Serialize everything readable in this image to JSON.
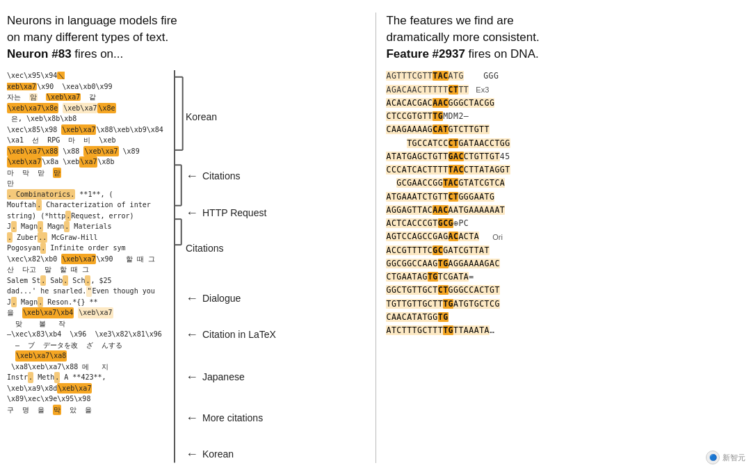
{
  "left_header": {
    "line1": "Neurons in language models fire",
    "line2": "on many different types of text.",
    "bold_part": "Neuron #83",
    "line3_suffix": " fires on..."
  },
  "right_header": {
    "line1": "The features we find are",
    "line2": "dramatically more consistent.",
    "bold_part": "Feature #2937",
    "line3_suffix": " fires on DNA."
  },
  "annotations": [
    {
      "type": "bracket",
      "label": "Korean"
    },
    {
      "type": "arrow",
      "label": "Citations"
    },
    {
      "type": "arrow",
      "label": "HTTP Request"
    },
    {
      "type": "bracket",
      "label": "Citations"
    },
    {
      "type": "arrow",
      "label": "Dialogue"
    },
    {
      "type": "arrow",
      "label": "Citation in LaTeX"
    },
    {
      "type": "arrow",
      "label": "Japanese"
    },
    {
      "type": "arrow",
      "label": "More citations"
    },
    {
      "type": "arrow",
      "label": "Korean"
    }
  ],
  "dna_rows": [
    {
      "pre": "AGTTTCGTT",
      "bold_hl": "TAC",
      "post": "ATG",
      "extra": "GGG",
      "label": ""
    },
    {
      "pre": "AGACAACTTTTT",
      "bold_hl": "CT",
      "post": "TT",
      "extra": "Ex3",
      "label": ""
    },
    {
      "pre": "ACACACGAC",
      "bold_hl": "AAC",
      "post": "GGGCTACGG",
      "extra": "",
      "label": ""
    },
    {
      "pre": "CTCCGTGTT",
      "bold_hl": "TG",
      "post": "MDM2–",
      "extra": "",
      "label": ""
    },
    {
      "pre": "CAAGAAAAG",
      "bold_hl": "CAT",
      "post": "GTCTTGTT",
      "extra": "",
      "label": ""
    },
    {
      "pre": "TGCCATCC",
      "bold_hl": "CT",
      "post": "GATAACCTGG",
      "extra": "",
      "label": ""
    },
    {
      "pre": "ATATGAGCTGTT",
      "bold_hl": "GAC",
      "post": "CTGTTGT45",
      "extra": "",
      "label": ""
    },
    {
      "pre": "CCCATCACTTTT",
      "bold_hl": "TAC",
      "post": "CTTATAGGT",
      "extra": "",
      "label": ""
    },
    {
      "pre": "GCGAACCGG",
      "bold_hl": "TAC",
      "post": "GTATCGTCA",
      "extra": "",
      "label": ""
    },
    {
      "pre": "ATGAAATCTGTT",
      "bold_hl": "CT",
      "post": "GGGAATG",
      "extra": "",
      "label": ""
    },
    {
      "pre": "AGGAGTTAC",
      "bold_hl": "AAC",
      "post": "AATGAAAAAAT",
      "extra": "",
      "label": ""
    },
    {
      "pre": "ACTCACCCGT",
      "bold_hl": "GCG",
      "post": "⊕PC",
      "extra": "",
      "label": ""
    },
    {
      "pre": "AGTCCAGCCGAG",
      "bold_hl": "AC",
      "post": "ACTA",
      "extra": "Ori",
      "label": ""
    },
    {
      "pre": "ACCGTTTTC",
      "bold_hl": "GC",
      "post": "GATCGTTAT",
      "extra": "",
      "label": ""
    },
    {
      "pre": "GGCGGCCAAG",
      "bold_hl": "TG",
      "post": "AGGAAAAGAC",
      "extra": "",
      "label": ""
    },
    {
      "pre": "CTGAATAG",
      "bold_hl": "TG",
      "post": "TCGATA=",
      "extra": "",
      "label": ""
    },
    {
      "pre": "GGCTGTTGCT",
      "bold_hl": "CT",
      "post": "GGGCCACTGT",
      "extra": "",
      "label": ""
    },
    {
      "pre": "TGTTGTTGCTT",
      "bold_hl": "TG",
      "post": "ATGTGCTCG",
      "extra": "",
      "label": ""
    },
    {
      "pre": "CAACATATGG",
      "bold_hl": "TG",
      "post": "",
      "extra": "",
      "label": ""
    },
    {
      "pre": "ATCTTTGCTTT",
      "bold_hl": "TG",
      "post": "TTAAATA",
      "extra": "…",
      "label": ""
    }
  ],
  "watermark_text": "新智元"
}
